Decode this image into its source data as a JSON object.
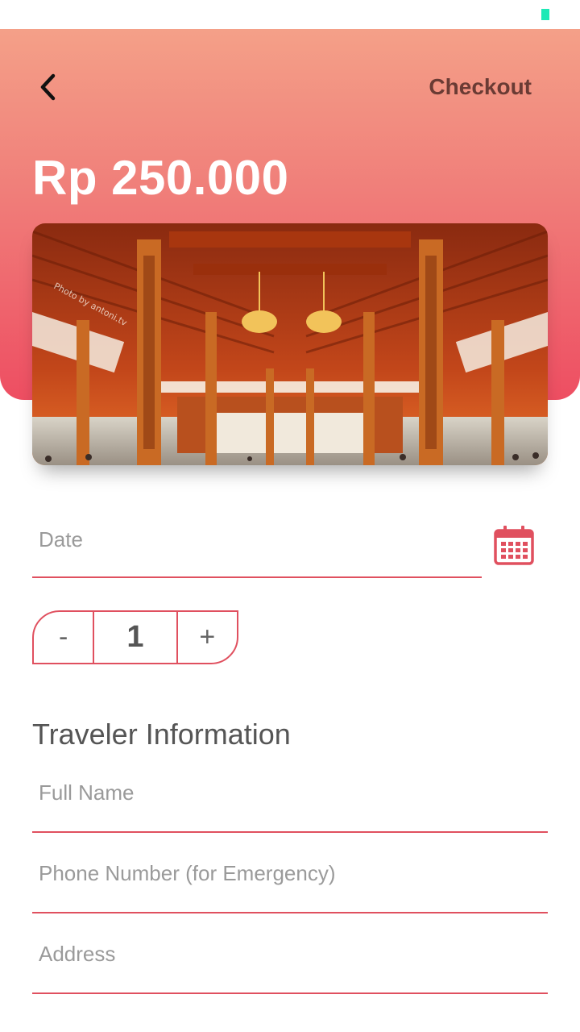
{
  "header": {
    "back_icon": "chevron-left-icon",
    "title": "Checkout",
    "price": "Rp 250.000"
  },
  "hero": {
    "watermark": "Photo by antoni.tv"
  },
  "booking": {
    "date_placeholder": "Date",
    "calendar_icon": "calendar-icon",
    "quantity_minus": "-",
    "quantity_value": "1",
    "quantity_plus": "+"
  },
  "traveler": {
    "section_title": "Traveler Information",
    "full_name_placeholder": "Full Name",
    "phone_placeholder": "Phone Number (for Emergency)",
    "address_placeholder": "Address"
  },
  "colors": {
    "accent": "#e0505f",
    "gradient_top": "#f4a088",
    "gradient_bottom": "#ee4e62",
    "status_indicator": "#1de9b6"
  }
}
